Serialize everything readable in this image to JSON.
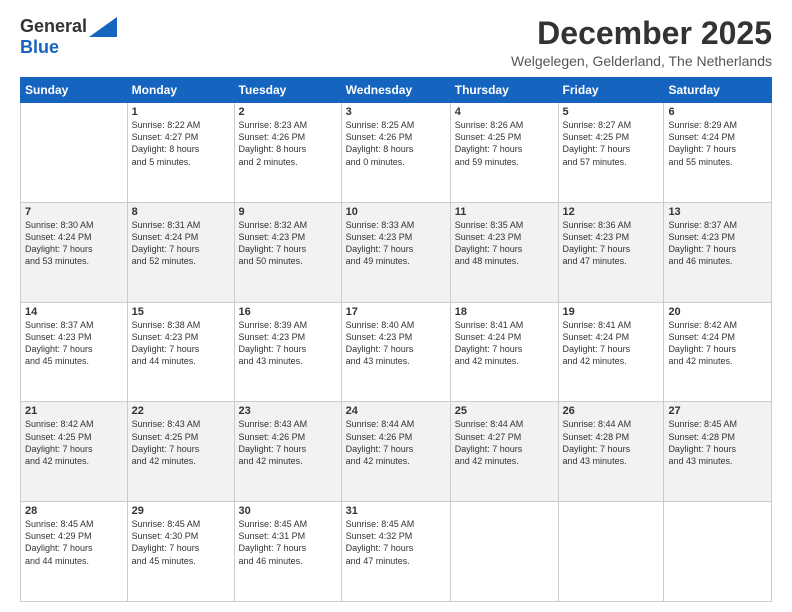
{
  "logo": {
    "general": "General",
    "blue": "Blue"
  },
  "header": {
    "month_year": "December 2025",
    "location": "Welgelegen, Gelderland, The Netherlands"
  },
  "days_of_week": [
    "Sunday",
    "Monday",
    "Tuesday",
    "Wednesday",
    "Thursday",
    "Friday",
    "Saturday"
  ],
  "weeks": [
    [
      {
        "day": "",
        "info": ""
      },
      {
        "day": "1",
        "info": "Sunrise: 8:22 AM\nSunset: 4:27 PM\nDaylight: 8 hours\nand 5 minutes."
      },
      {
        "day": "2",
        "info": "Sunrise: 8:23 AM\nSunset: 4:26 PM\nDaylight: 8 hours\nand 2 minutes."
      },
      {
        "day": "3",
        "info": "Sunrise: 8:25 AM\nSunset: 4:26 PM\nDaylight: 8 hours\nand 0 minutes."
      },
      {
        "day": "4",
        "info": "Sunrise: 8:26 AM\nSunset: 4:25 PM\nDaylight: 7 hours\nand 59 minutes."
      },
      {
        "day": "5",
        "info": "Sunrise: 8:27 AM\nSunset: 4:25 PM\nDaylight: 7 hours\nand 57 minutes."
      },
      {
        "day": "6",
        "info": "Sunrise: 8:29 AM\nSunset: 4:24 PM\nDaylight: 7 hours\nand 55 minutes."
      }
    ],
    [
      {
        "day": "7",
        "info": "Sunrise: 8:30 AM\nSunset: 4:24 PM\nDaylight: 7 hours\nand 53 minutes."
      },
      {
        "day": "8",
        "info": "Sunrise: 8:31 AM\nSunset: 4:24 PM\nDaylight: 7 hours\nand 52 minutes."
      },
      {
        "day": "9",
        "info": "Sunrise: 8:32 AM\nSunset: 4:23 PM\nDaylight: 7 hours\nand 50 minutes."
      },
      {
        "day": "10",
        "info": "Sunrise: 8:33 AM\nSunset: 4:23 PM\nDaylight: 7 hours\nand 49 minutes."
      },
      {
        "day": "11",
        "info": "Sunrise: 8:35 AM\nSunset: 4:23 PM\nDaylight: 7 hours\nand 48 minutes."
      },
      {
        "day": "12",
        "info": "Sunrise: 8:36 AM\nSunset: 4:23 PM\nDaylight: 7 hours\nand 47 minutes."
      },
      {
        "day": "13",
        "info": "Sunrise: 8:37 AM\nSunset: 4:23 PM\nDaylight: 7 hours\nand 46 minutes."
      }
    ],
    [
      {
        "day": "14",
        "info": "Sunrise: 8:37 AM\nSunset: 4:23 PM\nDaylight: 7 hours\nand 45 minutes."
      },
      {
        "day": "15",
        "info": "Sunrise: 8:38 AM\nSunset: 4:23 PM\nDaylight: 7 hours\nand 44 minutes."
      },
      {
        "day": "16",
        "info": "Sunrise: 8:39 AM\nSunset: 4:23 PM\nDaylight: 7 hours\nand 43 minutes."
      },
      {
        "day": "17",
        "info": "Sunrise: 8:40 AM\nSunset: 4:23 PM\nDaylight: 7 hours\nand 43 minutes."
      },
      {
        "day": "18",
        "info": "Sunrise: 8:41 AM\nSunset: 4:24 PM\nDaylight: 7 hours\nand 42 minutes."
      },
      {
        "day": "19",
        "info": "Sunrise: 8:41 AM\nSunset: 4:24 PM\nDaylight: 7 hours\nand 42 minutes."
      },
      {
        "day": "20",
        "info": "Sunrise: 8:42 AM\nSunset: 4:24 PM\nDaylight: 7 hours\nand 42 minutes."
      }
    ],
    [
      {
        "day": "21",
        "info": "Sunrise: 8:42 AM\nSunset: 4:25 PM\nDaylight: 7 hours\nand 42 minutes."
      },
      {
        "day": "22",
        "info": "Sunrise: 8:43 AM\nSunset: 4:25 PM\nDaylight: 7 hours\nand 42 minutes."
      },
      {
        "day": "23",
        "info": "Sunrise: 8:43 AM\nSunset: 4:26 PM\nDaylight: 7 hours\nand 42 minutes."
      },
      {
        "day": "24",
        "info": "Sunrise: 8:44 AM\nSunset: 4:26 PM\nDaylight: 7 hours\nand 42 minutes."
      },
      {
        "day": "25",
        "info": "Sunrise: 8:44 AM\nSunset: 4:27 PM\nDaylight: 7 hours\nand 42 minutes."
      },
      {
        "day": "26",
        "info": "Sunrise: 8:44 AM\nSunset: 4:28 PM\nDaylight: 7 hours\nand 43 minutes."
      },
      {
        "day": "27",
        "info": "Sunrise: 8:45 AM\nSunset: 4:28 PM\nDaylight: 7 hours\nand 43 minutes."
      }
    ],
    [
      {
        "day": "28",
        "info": "Sunrise: 8:45 AM\nSunset: 4:29 PM\nDaylight: 7 hours\nand 44 minutes."
      },
      {
        "day": "29",
        "info": "Sunrise: 8:45 AM\nSunset: 4:30 PM\nDaylight: 7 hours\nand 45 minutes."
      },
      {
        "day": "30",
        "info": "Sunrise: 8:45 AM\nSunset: 4:31 PM\nDaylight: 7 hours\nand 46 minutes."
      },
      {
        "day": "31",
        "info": "Sunrise: 8:45 AM\nSunset: 4:32 PM\nDaylight: 7 hours\nand 47 minutes."
      },
      {
        "day": "",
        "info": ""
      },
      {
        "day": "",
        "info": ""
      },
      {
        "day": "",
        "info": ""
      }
    ]
  ]
}
